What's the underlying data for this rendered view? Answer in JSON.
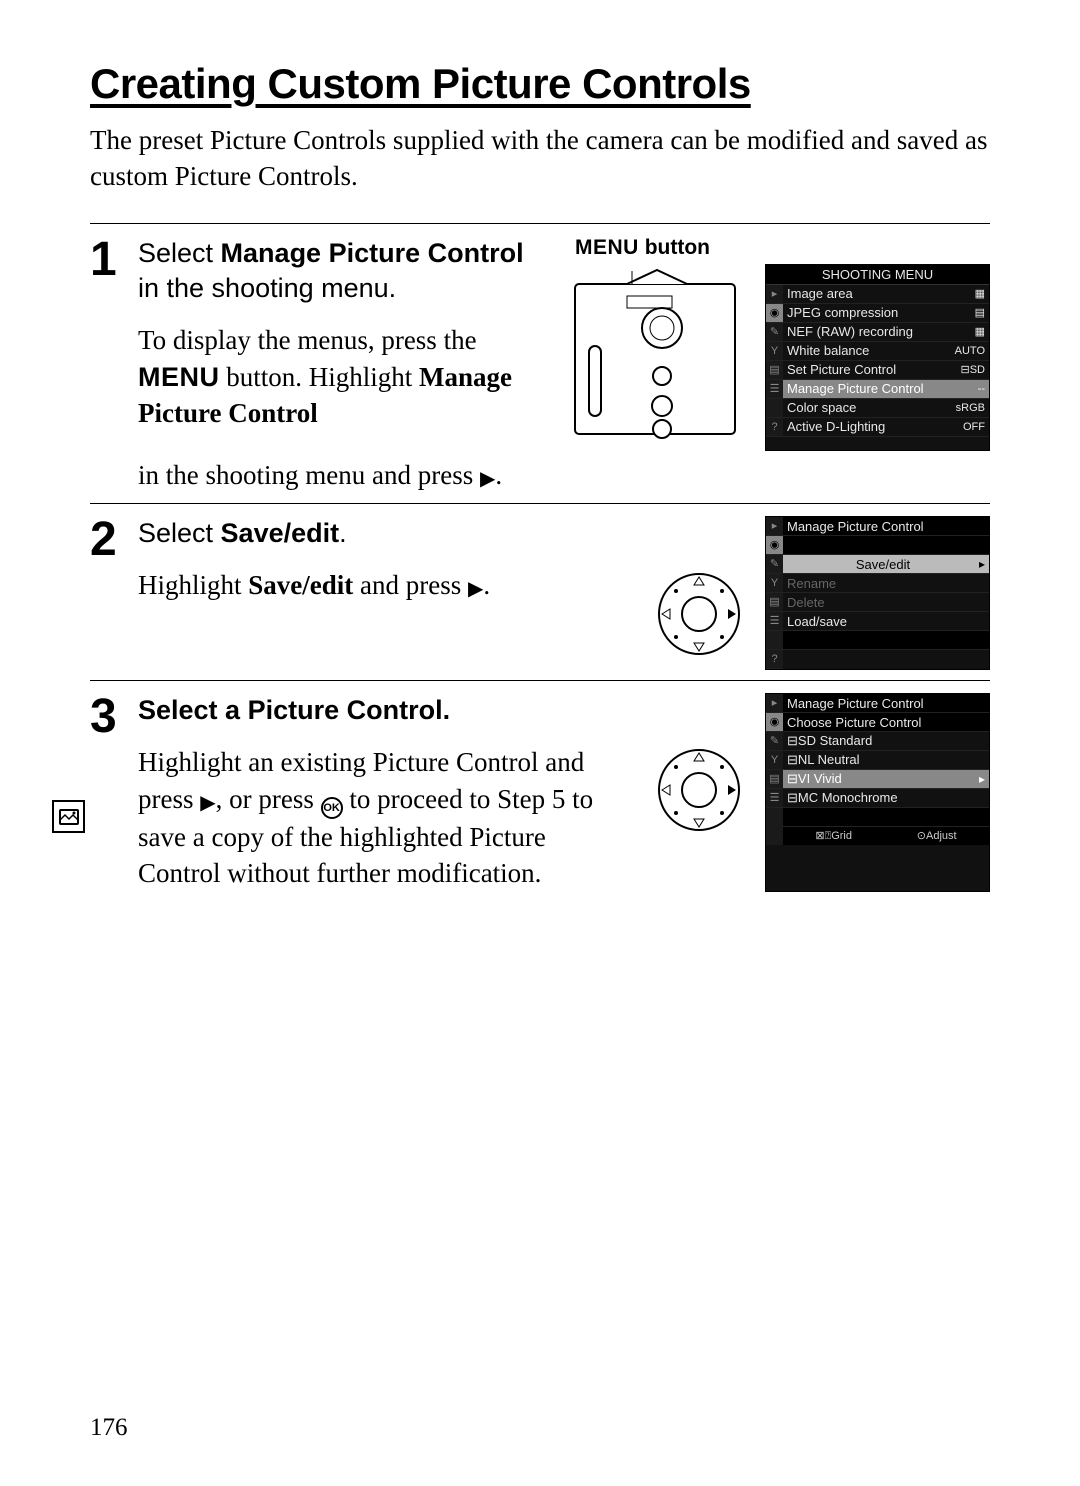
{
  "page_number": "176",
  "title": "Creating Custom Picture Controls",
  "intro": "The preset Picture Controls supplied with the camera can be modified and saved as custom Picture Controls.",
  "menu_button_label": "button",
  "menu_word": "MENU",
  "steps": {
    "s1": {
      "num": "1",
      "heading_pre": "Select ",
      "heading_bold": "Manage Picture Control",
      "heading_post": " in the shooting menu.",
      "note_a": "To display the menus, press the ",
      "note_b": " button. Highlight ",
      "note_bold": "Manage Picture Control",
      "note_c": " in the shooting menu and press "
    },
    "s2": {
      "num": "2",
      "heading_pre": "Select ",
      "heading_bold": "Save/edit",
      "heading_post": ".",
      "note_a": "Highlight ",
      "note_bold": "Save/edit",
      "note_b": " and press "
    },
    "s3": {
      "num": "3",
      "heading": "Select a Picture Control.",
      "note_a": "Highlight an existing Picture Control and press ",
      "note_b": ", or press ",
      "note_c": " to proceed to Step 5 to save a copy of the highlighted Picture Control without further modification."
    }
  },
  "lcd1": {
    "title": "SHOOTING MENU",
    "rows": [
      {
        "label": "Image area",
        "val": "▦"
      },
      {
        "label": "JPEG compression",
        "val": "▤"
      },
      {
        "label": "NEF (RAW) recording",
        "val": "▦"
      },
      {
        "label": "White balance",
        "val": "AUTO"
      },
      {
        "label": "Set Picture Control",
        "val": "⊟SD"
      },
      {
        "label": "Manage Picture Control",
        "val": "--",
        "sel": true
      },
      {
        "label": "Color space",
        "val": "sRGB"
      },
      {
        "label": "Active D-Lighting",
        "val": "OFF"
      }
    ]
  },
  "lcd2": {
    "title": "Manage Picture Control",
    "rows": [
      {
        "label": "Save/edit",
        "sel": true,
        "arrow": "▸"
      },
      {
        "label": "Rename",
        "dim": true
      },
      {
        "label": "Delete",
        "dim": true
      },
      {
        "label": "Load/save"
      }
    ]
  },
  "lcd3": {
    "title": "Manage Picture Control",
    "subtitle": "Choose Picture Control",
    "rows": [
      {
        "label": "⊟SD Standard"
      },
      {
        "label": "⊟NL Neutral"
      },
      {
        "label": "⊟VI Vivid",
        "sel": true,
        "arrow": "▸"
      },
      {
        "label": "⊟MC Monochrome"
      }
    ],
    "footer_left": "⊠⍰Grid",
    "footer_right": "⊙Adjust"
  },
  "icons": {
    "triangle_right": "▶",
    "ok": "OK"
  }
}
